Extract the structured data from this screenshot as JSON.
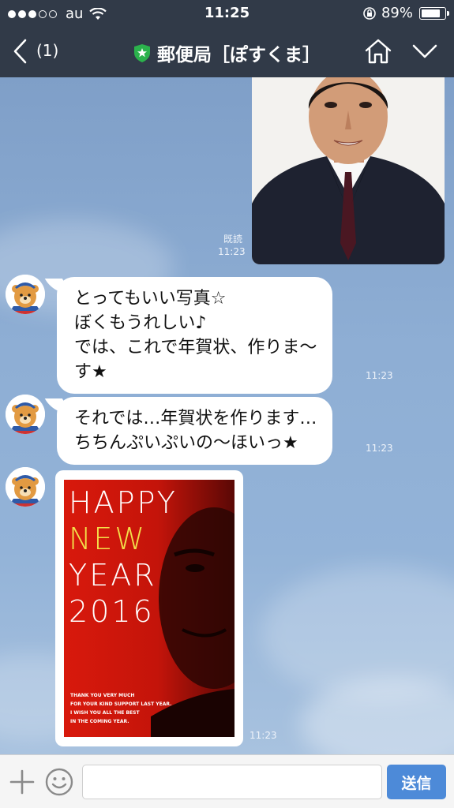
{
  "status_bar": {
    "carrier": "au",
    "time": "11:25",
    "battery": "89%",
    "battery_level": 0.89,
    "signal_dots_filled": 3,
    "signal_dots_total": 5
  },
  "header": {
    "back_count": "(1)",
    "title": "郵便局［ぽすくま］",
    "accent_color": "#2bb24c"
  },
  "messages": [
    {
      "type": "image",
      "direction": "sent",
      "read_label": "既読",
      "time": "11:23",
      "description": "photo"
    },
    {
      "type": "text",
      "direction": "received",
      "lines": [
        "とってもいい写真☆",
        "ぼくもうれしい♪",
        "では、これで年賀状、作りま〜",
        "す★"
      ],
      "time": "11:23"
    },
    {
      "type": "text",
      "direction": "received",
      "lines": [
        "それでは…年賀状を作ります…",
        "ちちんぷいぷいの〜ほいっ★"
      ],
      "time": "11:23"
    },
    {
      "type": "image",
      "direction": "received",
      "time": "11:23",
      "card": {
        "headline": [
          "HAPPY",
          "NEW",
          "YEAR",
          "2016"
        ],
        "footer": [
          "THANK YOU VERY MUCH",
          "FOR YOUR KIND SUPPORT LAST YEAR.",
          "I WISH YOU ALL THE BEST",
          "IN THE COMING YEAR."
        ]
      }
    }
  ],
  "input_bar": {
    "placeholder": "",
    "send_label": "送信"
  },
  "colors": {
    "header_bg": "#313a48",
    "chat_bg": "#8eaed4",
    "send_button": "#4d8ad8"
  }
}
